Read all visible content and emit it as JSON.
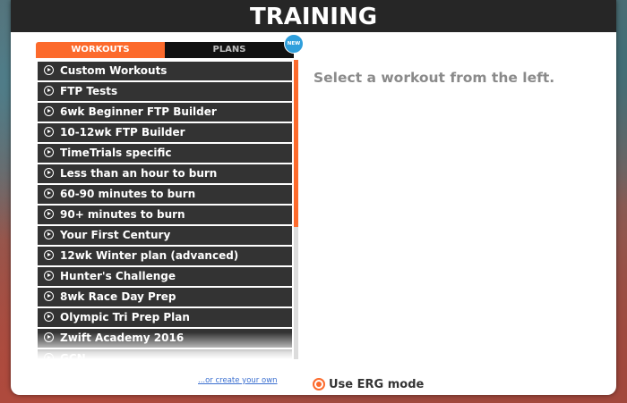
{
  "header": {
    "title": "TRAINING"
  },
  "tabs": [
    {
      "label": "WORKOUTS",
      "active": true
    },
    {
      "label": "PLANS",
      "active": false
    }
  ],
  "new_badge": "NEW",
  "workout_list": {
    "items": [
      {
        "label": "Custom Workouts"
      },
      {
        "label": "FTP Tests"
      },
      {
        "label": "6wk Beginner FTP Builder"
      },
      {
        "label": "10-12wk FTP Builder"
      },
      {
        "label": "TimeTrials specific"
      },
      {
        "label": "Less than an hour to burn"
      },
      {
        "label": "60-90 minutes to burn"
      },
      {
        "label": "90+ minutes to burn"
      },
      {
        "label": "Your First Century"
      },
      {
        "label": "12wk Winter plan (advanced)"
      },
      {
        "label": "Hunter's Challenge"
      },
      {
        "label": "8wk Race Day Prep"
      },
      {
        "label": "Olympic Tri Prep Plan"
      },
      {
        "label": "Zwift Academy 2016"
      },
      {
        "label": "GCN"
      }
    ]
  },
  "main": {
    "empty_message": "Select a workout from the left."
  },
  "footer": {
    "create_link": "...or create your own",
    "erg_label": "Use ERG mode",
    "erg_enabled": true
  },
  "colors": {
    "accent": "#fc6a2c",
    "header_bg": "#262626",
    "list_item_bg": "#333333",
    "badge": "#2f9fdc"
  }
}
